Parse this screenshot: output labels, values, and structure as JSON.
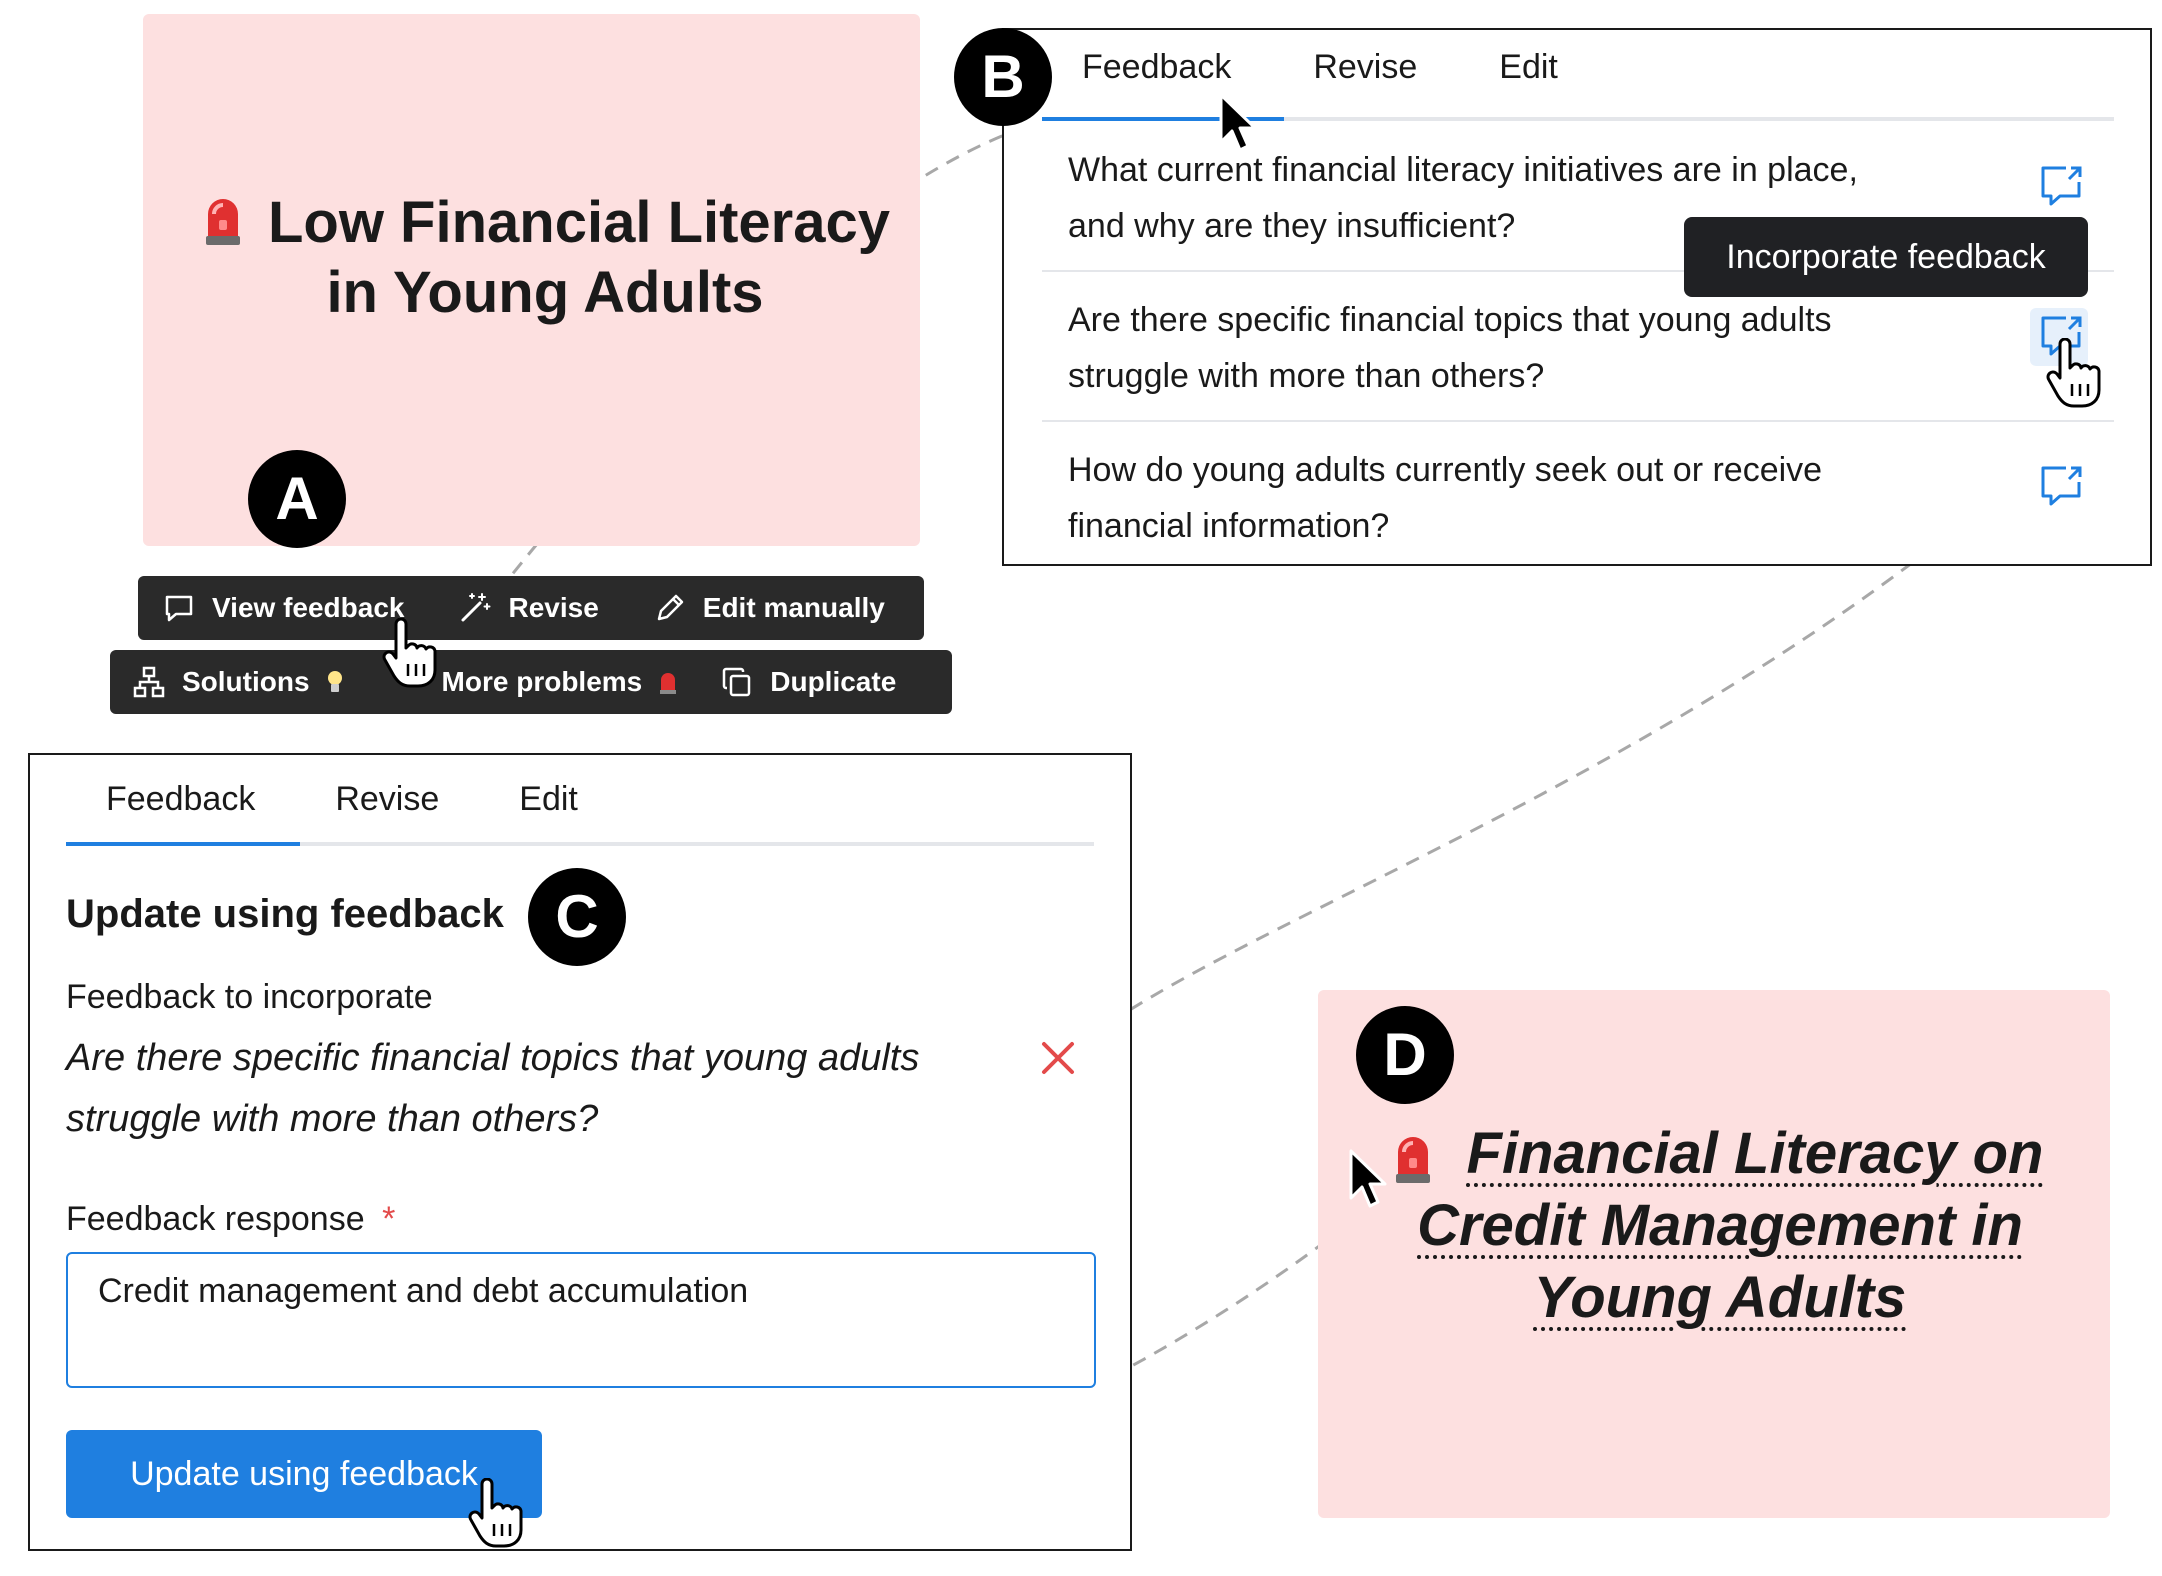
{
  "labels": {
    "a": "A",
    "b": "B",
    "c": "C",
    "d": "D"
  },
  "panel_a": {
    "problem_title_line1": "Low Financial Literacy",
    "problem_title_line2": "in Young Adults",
    "toolbar_row1": [
      {
        "label": "View feedback",
        "icon": "chat-bubble-icon"
      },
      {
        "label": "Revise",
        "icon": "magic-wand-icon"
      },
      {
        "label": "Edit manually",
        "icon": "pencil-icon"
      }
    ],
    "toolbar_row2": [
      {
        "label": "Solutions",
        "icon": "hierarchy-icon",
        "suffix_icon": "lightbulb-icon"
      },
      {
        "label": "More problems",
        "icon": "hierarchy-icon",
        "suffix_icon": "siren-icon"
      },
      {
        "label": "Duplicate",
        "icon": "copy-icon"
      }
    ]
  },
  "panel_b": {
    "tabs": [
      "Feedback",
      "Revise",
      "Edit"
    ],
    "active_tab": "Feedback",
    "questions": [
      {
        "line1": "What current financial literacy initiatives are in place,",
        "line2": "and why are they insufficient?"
      },
      {
        "line1": "Are there specific financial topics that young adults",
        "line2": "struggle with more than others?"
      },
      {
        "line1": "How do young adults currently seek out or receive",
        "line2": "financial information?"
      }
    ],
    "tooltip": "Incorporate feedback"
  },
  "panel_c": {
    "tabs": [
      "Feedback",
      "Revise",
      "Edit"
    ],
    "active_tab": "Feedback",
    "heading": "Update using feedback",
    "feedback_label": "Feedback to incorporate",
    "feedback_line1": "Are there specific financial topics that young adults",
    "feedback_line2": "struggle with more than others?",
    "response_label": "Feedback response",
    "required_mark": "*",
    "response_value": "Credit management and debt accumulation",
    "button_label": "Update using feedback"
  },
  "panel_d": {
    "title_line1": "Financial Literacy on",
    "title_line2": "Credit Management in",
    "title_line3": "Young Adults"
  },
  "colors": {
    "card_pink": "#fde0e0",
    "accent_blue": "#1f7fe0",
    "toolbar_dark": "#2a2a2a",
    "remove_red": "#e34a4a"
  }
}
